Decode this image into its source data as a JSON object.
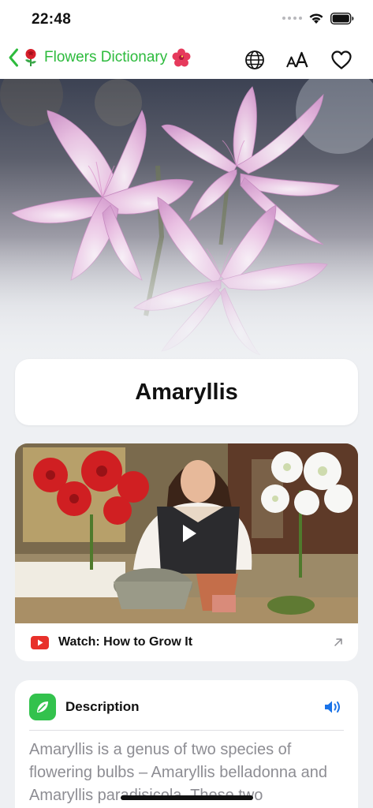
{
  "status_bar": {
    "time": "22:48"
  },
  "nav": {
    "title": "Flowers Dictionary",
    "title_prefix_icon": "rose-emoji",
    "title_suffix_icon": "hibiscus-emoji",
    "actions": [
      "globe-icon",
      "text-size-icon",
      "heart-icon"
    ],
    "text_size_label": "AA"
  },
  "hero": {
    "image": "amaryllis-belladonna-pink-flowers-photo"
  },
  "flower": {
    "name": "Amaryllis"
  },
  "video": {
    "label": "Watch: How to Grow It",
    "icon": "youtube-icon"
  },
  "description": {
    "title": "Description",
    "text": "Amaryllis is a genus of two species of flowering bulbs – Amaryllis belladonna and Amaryllis paradisicola. These two"
  },
  "colors": {
    "accent_green": "#2dbb3d",
    "link_blue": "#1a73e8",
    "youtube_red": "#e8312b",
    "badge_green": "#33c24d"
  }
}
